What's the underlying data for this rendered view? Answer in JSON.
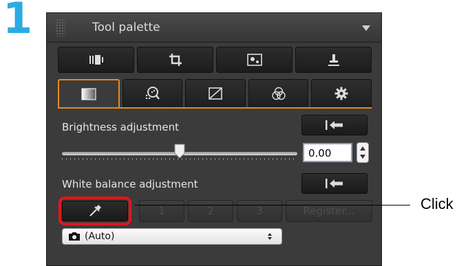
{
  "step_number": "1",
  "palette": {
    "title": "Tool palette",
    "tools": [
      {
        "icon": "filmstrip-icon"
      },
      {
        "icon": "crop-icon"
      },
      {
        "icon": "dust-delete-icon"
      },
      {
        "icon": "stamp-icon"
      }
    ],
    "tabs": [
      {
        "icon": "basic-adjustment-icon",
        "active": true
      },
      {
        "icon": "magnifier-dots-icon",
        "active": false
      },
      {
        "icon": "tone-curve-icon",
        "active": false
      },
      {
        "icon": "color-circles-icon",
        "active": false
      },
      {
        "icon": "gear-icon",
        "active": false
      }
    ],
    "brightness": {
      "label": "Brightness adjustment",
      "value": "0.00",
      "slider_fraction": 0.5
    },
    "white_balance": {
      "label": "White balance adjustment",
      "custom_buttons": [
        "1",
        "2",
        "3"
      ],
      "register_label": "Register...",
      "preset": "(Auto)"
    }
  },
  "callout": {
    "text": "Click"
  },
  "colors": {
    "accent": "#e38b1f",
    "highlight": "#e2161b",
    "step": "#29abe2"
  }
}
